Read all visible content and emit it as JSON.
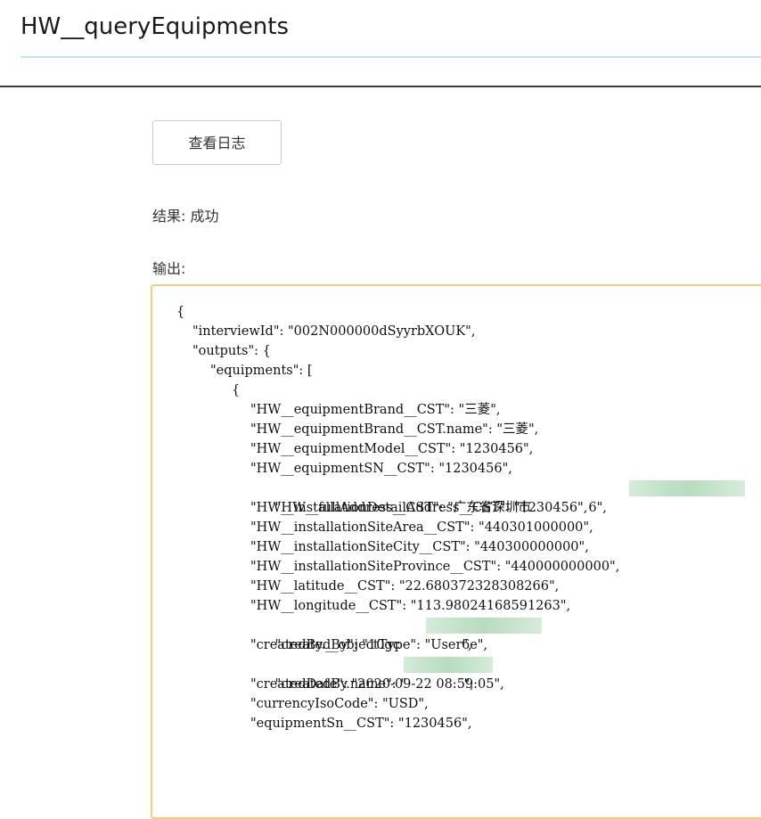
{
  "page": {
    "title": "HW__queryEquipments",
    "log_button_label": "查看日志",
    "result_text": "结果: 成功",
    "output_label": "输出:"
  },
  "json_output": {
    "lines": [
      "{",
      "\"interviewId\": \"002N000000dSyyrbXOUK\",",
      "\"outputs\": {",
      "\"equipments\": [",
      "{",
      "\"HW__equipmentBrand__CST\": \"三菱\",",
      "\"HW__equipmentBrand__CST.name\": \"三菱\",",
      "\"HW__equipmentModel__CST\": \"1230456\",",
      "\"HW__equipmentSN__CST\": \"1230456\",",
      "\"HW__fullAddress__CST\": \"广东省深圳市              6\",",
      "\"HW__installationDetailAddress__CST\": \"1230456\",",
      "\"HW__installationSiteArea__CST\": \"440301000000\",",
      "\"HW__installationSiteCity__CST\": \"440300000000\",",
      "\"HW__installationSiteProvince__CST\": \"440000000000\",",
      "\"HW__latitude__CST\": \"22.680372328308266\",",
      "\"HW__longitude__CST\": \"113.98024168591263\",",
      "\"createdBy\": \"10gc               6e\",",
      "\"createdBy.__objectType\": \"User\",",
      "\"createdBy.name\": \"              \",",
      "\"createdDate\": \"2020-09-22 08:59:05\",",
      "\"currencyIsoCode\": \"USD\",",
      "\"equipmentSn__CST\": \"1230456\","
    ]
  }
}
